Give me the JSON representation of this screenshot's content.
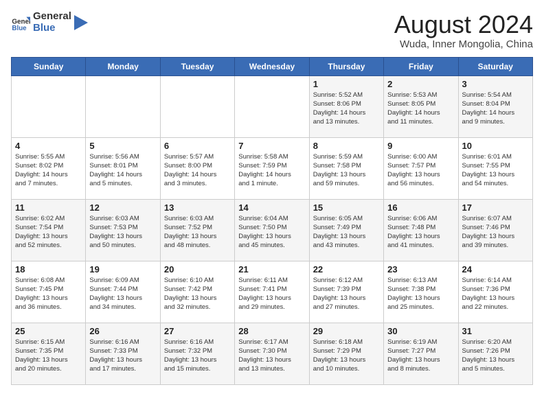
{
  "header": {
    "logo_general": "General",
    "logo_blue": "Blue",
    "title": "August 2024",
    "subtitle": "Wuda, Inner Mongolia, China"
  },
  "calendar": {
    "days_of_week": [
      "Sunday",
      "Monday",
      "Tuesday",
      "Wednesday",
      "Thursday",
      "Friday",
      "Saturday"
    ],
    "weeks": [
      [
        {
          "day": "",
          "info": ""
        },
        {
          "day": "",
          "info": ""
        },
        {
          "day": "",
          "info": ""
        },
        {
          "day": "",
          "info": ""
        },
        {
          "day": "1",
          "info": "Sunrise: 5:52 AM\nSunset: 8:06 PM\nDaylight: 14 hours\nand 13 minutes."
        },
        {
          "day": "2",
          "info": "Sunrise: 5:53 AM\nSunset: 8:05 PM\nDaylight: 14 hours\nand 11 minutes."
        },
        {
          "day": "3",
          "info": "Sunrise: 5:54 AM\nSunset: 8:04 PM\nDaylight: 14 hours\nand 9 minutes."
        }
      ],
      [
        {
          "day": "4",
          "info": "Sunrise: 5:55 AM\nSunset: 8:02 PM\nDaylight: 14 hours\nand 7 minutes."
        },
        {
          "day": "5",
          "info": "Sunrise: 5:56 AM\nSunset: 8:01 PM\nDaylight: 14 hours\nand 5 minutes."
        },
        {
          "day": "6",
          "info": "Sunrise: 5:57 AM\nSunset: 8:00 PM\nDaylight: 14 hours\nand 3 minutes."
        },
        {
          "day": "7",
          "info": "Sunrise: 5:58 AM\nSunset: 7:59 PM\nDaylight: 14 hours\nand 1 minute."
        },
        {
          "day": "8",
          "info": "Sunrise: 5:59 AM\nSunset: 7:58 PM\nDaylight: 13 hours\nand 59 minutes."
        },
        {
          "day": "9",
          "info": "Sunrise: 6:00 AM\nSunset: 7:57 PM\nDaylight: 13 hours\nand 56 minutes."
        },
        {
          "day": "10",
          "info": "Sunrise: 6:01 AM\nSunset: 7:55 PM\nDaylight: 13 hours\nand 54 minutes."
        }
      ],
      [
        {
          "day": "11",
          "info": "Sunrise: 6:02 AM\nSunset: 7:54 PM\nDaylight: 13 hours\nand 52 minutes."
        },
        {
          "day": "12",
          "info": "Sunrise: 6:03 AM\nSunset: 7:53 PM\nDaylight: 13 hours\nand 50 minutes."
        },
        {
          "day": "13",
          "info": "Sunrise: 6:03 AM\nSunset: 7:52 PM\nDaylight: 13 hours\nand 48 minutes."
        },
        {
          "day": "14",
          "info": "Sunrise: 6:04 AM\nSunset: 7:50 PM\nDaylight: 13 hours\nand 45 minutes."
        },
        {
          "day": "15",
          "info": "Sunrise: 6:05 AM\nSunset: 7:49 PM\nDaylight: 13 hours\nand 43 minutes."
        },
        {
          "day": "16",
          "info": "Sunrise: 6:06 AM\nSunset: 7:48 PM\nDaylight: 13 hours\nand 41 minutes."
        },
        {
          "day": "17",
          "info": "Sunrise: 6:07 AM\nSunset: 7:46 PM\nDaylight: 13 hours\nand 39 minutes."
        }
      ],
      [
        {
          "day": "18",
          "info": "Sunrise: 6:08 AM\nSunset: 7:45 PM\nDaylight: 13 hours\nand 36 minutes."
        },
        {
          "day": "19",
          "info": "Sunrise: 6:09 AM\nSunset: 7:44 PM\nDaylight: 13 hours\nand 34 minutes."
        },
        {
          "day": "20",
          "info": "Sunrise: 6:10 AM\nSunset: 7:42 PM\nDaylight: 13 hours\nand 32 minutes."
        },
        {
          "day": "21",
          "info": "Sunrise: 6:11 AM\nSunset: 7:41 PM\nDaylight: 13 hours\nand 29 minutes."
        },
        {
          "day": "22",
          "info": "Sunrise: 6:12 AM\nSunset: 7:39 PM\nDaylight: 13 hours\nand 27 minutes."
        },
        {
          "day": "23",
          "info": "Sunrise: 6:13 AM\nSunset: 7:38 PM\nDaylight: 13 hours\nand 25 minutes."
        },
        {
          "day": "24",
          "info": "Sunrise: 6:14 AM\nSunset: 7:36 PM\nDaylight: 13 hours\nand 22 minutes."
        }
      ],
      [
        {
          "day": "25",
          "info": "Sunrise: 6:15 AM\nSunset: 7:35 PM\nDaylight: 13 hours\nand 20 minutes."
        },
        {
          "day": "26",
          "info": "Sunrise: 6:16 AM\nSunset: 7:33 PM\nDaylight: 13 hours\nand 17 minutes."
        },
        {
          "day": "27",
          "info": "Sunrise: 6:16 AM\nSunset: 7:32 PM\nDaylight: 13 hours\nand 15 minutes."
        },
        {
          "day": "28",
          "info": "Sunrise: 6:17 AM\nSunset: 7:30 PM\nDaylight: 13 hours\nand 13 minutes."
        },
        {
          "day": "29",
          "info": "Sunrise: 6:18 AM\nSunset: 7:29 PM\nDaylight: 13 hours\nand 10 minutes."
        },
        {
          "day": "30",
          "info": "Sunrise: 6:19 AM\nSunset: 7:27 PM\nDaylight: 13 hours\nand 8 minutes."
        },
        {
          "day": "31",
          "info": "Sunrise: 6:20 AM\nSunset: 7:26 PM\nDaylight: 13 hours\nand 5 minutes."
        }
      ]
    ]
  }
}
